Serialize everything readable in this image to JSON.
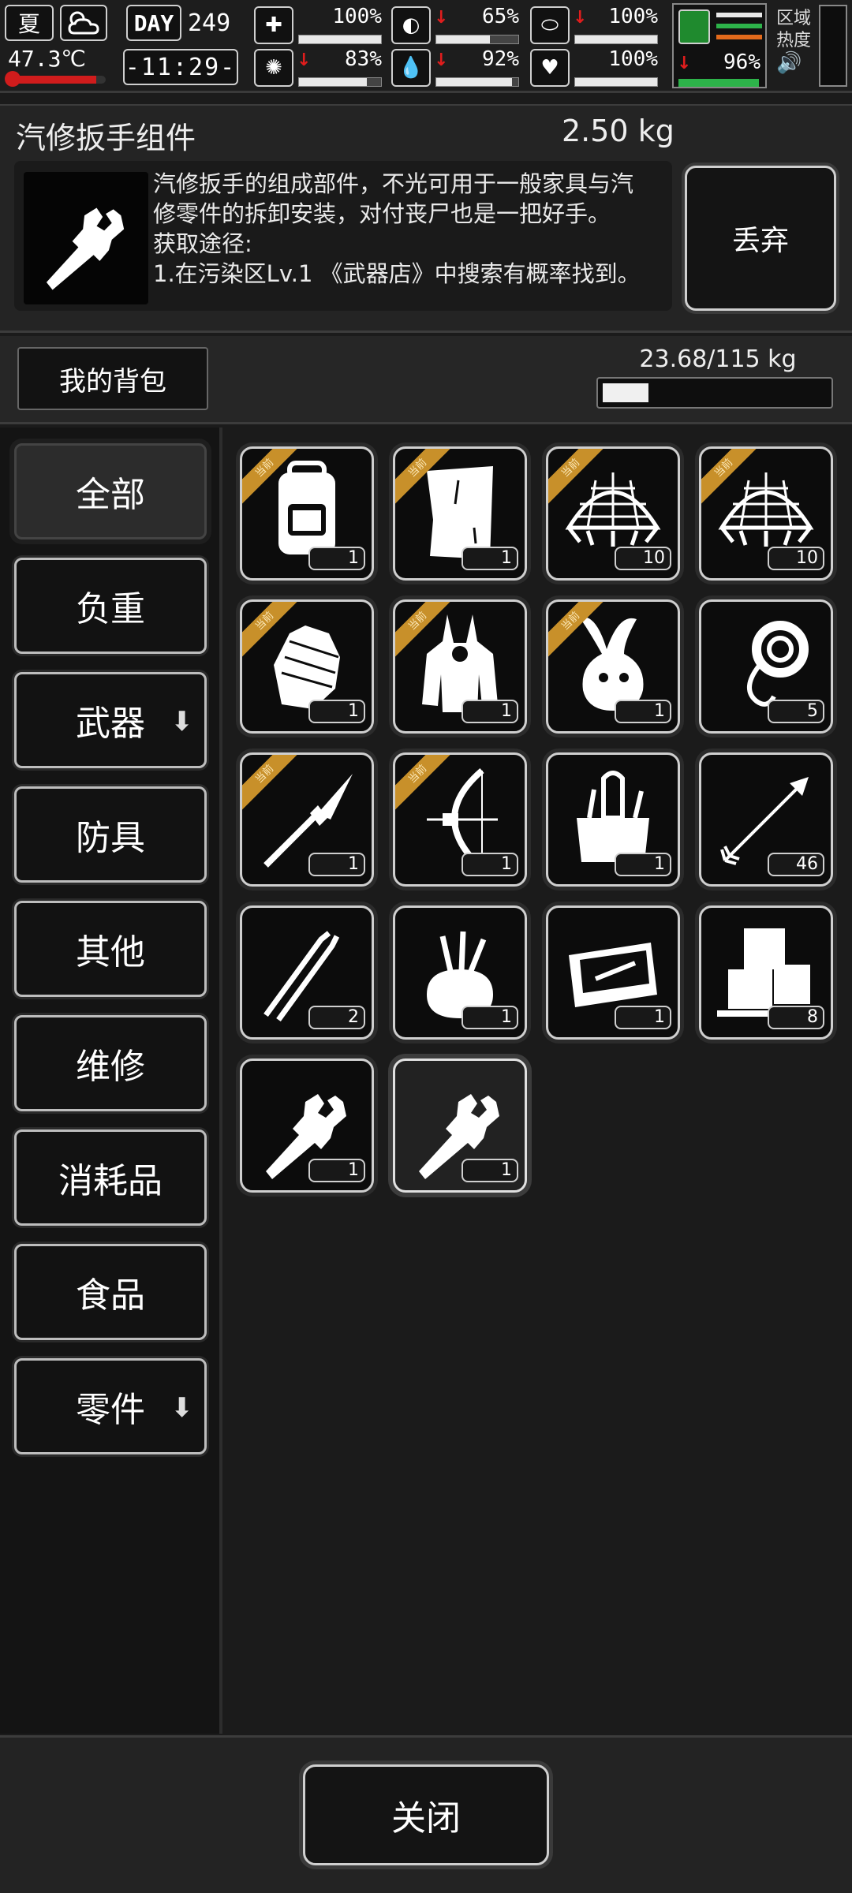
{
  "status": {
    "season": "夏",
    "weather_icon": "cloudy-sun-icon",
    "temperature": "47.3℃",
    "temperature_fill": 0.9,
    "day_label": "DAY",
    "day_number": "249",
    "clock": "-11:29-",
    "stats": [
      {
        "name": "health",
        "icon": "medkit-icon",
        "arrow": "",
        "value": "100%",
        "fill": 1.0
      },
      {
        "name": "hunger",
        "icon": "stomach-icon",
        "arrow": "down",
        "value": "65%",
        "fill": 0.65
      },
      {
        "name": "pill",
        "icon": "pill-icon",
        "arrow": "down",
        "value": "100%",
        "fill": 1.0
      },
      {
        "name": "brain",
        "icon": "brain-icon",
        "arrow": "down",
        "value": "83%",
        "fill": 0.83
      },
      {
        "name": "thirst",
        "icon": "water-drop-icon",
        "arrow": "down",
        "value": "92%",
        "fill": 0.92
      },
      {
        "name": "mood",
        "icon": "heart-icon",
        "arrow": "",
        "value": "100%",
        "fill": 1.0
      }
    ],
    "stamina": {
      "arrow": "down",
      "value": "96%",
      "fill": 0.96
    },
    "zone_label_1": "区域",
    "zone_label_2": "热度",
    "speaker_icon": "speaker-icon",
    "colors": {
      "danger": "#e11d1d",
      "stamina": "#2db34a",
      "tag": "#c8902a"
    }
  },
  "detail": {
    "name": "汽修扳手组件",
    "weight": "2.50 kg",
    "icon": "wrench-knife-icon",
    "description": "汽修扳手的组成部件，不光可用于一般家具与汽\n修零件的拆卸安装，对付丧尸也是一把好手。\n获取途径:\n1.在污染区Lv.1 《武器店》中搜索有概率找到。",
    "discard_label": "丢弃"
  },
  "bag": {
    "tab_label": "我的背包",
    "weight_text": "23.68/115 kg",
    "weight_fill": 0.2059
  },
  "categories": [
    {
      "label": "全部",
      "active": true,
      "arrow": false
    },
    {
      "label": "负重",
      "active": false,
      "arrow": false
    },
    {
      "label": "武器",
      "active": false,
      "arrow": true
    },
    {
      "label": "防具",
      "active": false,
      "arrow": false
    },
    {
      "label": "其他",
      "active": false,
      "arrow": false
    },
    {
      "label": "维修",
      "active": false,
      "arrow": false
    },
    {
      "label": "消耗品",
      "active": false,
      "arrow": false
    },
    {
      "label": "食品",
      "active": false,
      "arrow": false
    },
    {
      "label": "零件",
      "active": false,
      "arrow": true
    }
  ],
  "items": [
    {
      "icon": "backpack-icon",
      "count": "1",
      "tag": "当前"
    },
    {
      "icon": "paper-sheet-icon",
      "count": "1",
      "tag": "当前"
    },
    {
      "icon": "net-trap-icon",
      "count": "10",
      "tag": "当前"
    },
    {
      "icon": "net-trap-icon",
      "count": "10",
      "tag": "当前"
    },
    {
      "icon": "bandaged-glove-icon",
      "count": "1",
      "tag": "当前"
    },
    {
      "icon": "bunny-hoodie-icon",
      "count": "1",
      "tag": "当前"
    },
    {
      "icon": "bunny-hat-icon",
      "count": "1",
      "tag": "当前"
    },
    {
      "icon": "rope-icon",
      "count": "5",
      "tag": ""
    },
    {
      "icon": "spear-icon",
      "count": "1",
      "tag": "当前"
    },
    {
      "icon": "compound-bow-icon",
      "count": "1",
      "tag": "当前"
    },
    {
      "icon": "toolbox-icon",
      "count": "1",
      "tag": ""
    },
    {
      "icon": "arrow-icon",
      "count": "46",
      "tag": ""
    },
    {
      "icon": "tweezers-icon",
      "count": "2",
      "tag": ""
    },
    {
      "icon": "tool-pouch-icon",
      "count": "1",
      "tag": ""
    },
    {
      "icon": "tool-case-icon",
      "count": "1",
      "tag": ""
    },
    {
      "icon": "ice-cubes-icon",
      "count": "8",
      "tag": ""
    },
    {
      "icon": "wrench-knife-icon",
      "count": "1",
      "tag": ""
    },
    {
      "icon": "wrench-knife-icon",
      "count": "1",
      "tag": "",
      "selected": true
    }
  ],
  "footer": {
    "close_label": "关闭"
  }
}
